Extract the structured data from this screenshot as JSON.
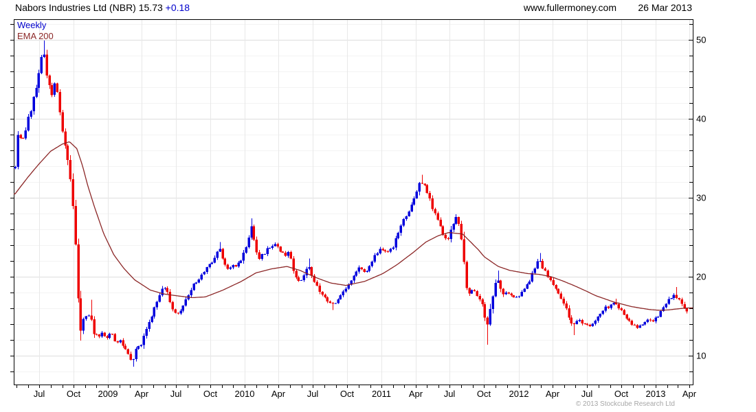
{
  "header": {
    "title_main": "Nabors Industries Ltd (NBR) 15.73",
    "change": "+0.18",
    "site": "www.fullermoney.com",
    "date": "26 Mar 2013"
  },
  "legend": {
    "timeframe": "Weekly",
    "overlay": "EMA 200"
  },
  "footer": {
    "copyright": "© 2013 Stockcube Research Ltd"
  },
  "colors": {
    "up": "#0000dd",
    "down": "#ee0000",
    "ema": "#8b2626",
    "change_text": "#0000cc",
    "legend_weekly": "#0000cc",
    "grid_major": "#dddddd",
    "grid_minor": "#f3f3f3",
    "grid_vertical": "#e8e8e8",
    "axis": "#000000",
    "copyright_text": "#a6a6a6"
  },
  "chart_data": {
    "type": "candlestick",
    "interval": "weekly",
    "instrument": "Nabors Industries Ltd (NBR)",
    "last_price": 15.73,
    "change": 0.18,
    "y_axis": {
      "side": "right",
      "ticks": [
        10,
        20,
        30,
        40,
        50
      ],
      "minor_step": 2,
      "min": 6.4,
      "max": 52.6
    },
    "x_axis": {
      "start": "2008-04-28",
      "end": "2013-03-26",
      "tick_labels": [
        {
          "d": "2008-07-01",
          "label": "Jul"
        },
        {
          "d": "2008-10-01",
          "label": "Oct"
        },
        {
          "d": "2009-01-01",
          "label": "2009"
        },
        {
          "d": "2009-04-01",
          "label": "Apr"
        },
        {
          "d": "2009-07-01",
          "label": "Jul"
        },
        {
          "d": "2009-10-01",
          "label": "Oct"
        },
        {
          "d": "2010-01-01",
          "label": "2010"
        },
        {
          "d": "2010-04-01",
          "label": "Apr"
        },
        {
          "d": "2010-07-01",
          "label": "Jul"
        },
        {
          "d": "2010-10-01",
          "label": "Oct"
        },
        {
          "d": "2011-01-01",
          "label": "2011"
        },
        {
          "d": "2011-04-01",
          "label": "Apr"
        },
        {
          "d": "2011-07-01",
          "label": "Jul"
        },
        {
          "d": "2011-10-01",
          "label": "Oct"
        },
        {
          "d": "2012-01-01",
          "label": "2012"
        },
        {
          "d": "2012-04-01",
          "label": "Apr"
        },
        {
          "d": "2012-07-01",
          "label": "Jul"
        },
        {
          "d": "2012-10-01",
          "label": "Oct"
        },
        {
          "d": "2013-01-01",
          "label": "2013"
        },
        {
          "d": "2013-04-01",
          "label": "Apr"
        }
      ]
    },
    "close_anchors": [
      [
        "2008-04-28",
        34.2
      ],
      [
        "2008-05-02",
        37.4
      ],
      [
        "2008-05-09",
        37.8
      ],
      [
        "2008-05-16",
        36.8
      ],
      [
        "2008-05-30",
        39.5
      ],
      [
        "2008-06-13",
        42.0
      ],
      [
        "2008-06-27",
        44.5
      ],
      [
        "2008-07-03",
        46.5
      ],
      [
        "2008-07-11",
        49.2
      ],
      [
        "2008-07-18",
        46.5
      ],
      [
        "2008-08-01",
        43.0
      ],
      [
        "2008-08-15",
        44.5
      ],
      [
        "2008-08-29",
        39.5
      ],
      [
        "2008-09-12",
        35.5
      ],
      [
        "2008-09-26",
        31.0
      ],
      [
        "2008-10-03",
        26.5
      ],
      [
        "2008-10-10",
        20.6
      ],
      [
        "2008-10-17",
        12.6
      ],
      [
        "2008-10-24",
        14.0
      ],
      [
        "2008-10-31",
        15.8
      ],
      [
        "2008-11-07",
        13.8
      ],
      [
        "2008-11-14",
        16.6
      ],
      [
        "2008-11-21",
        12.2
      ],
      [
        "2008-11-28",
        13.2
      ],
      [
        "2008-12-05",
        11.9
      ],
      [
        "2008-12-12",
        13.3
      ],
      [
        "2008-12-19",
        12.6
      ],
      [
        "2009-01-02",
        12.2
      ],
      [
        "2009-01-09",
        13.4
      ],
      [
        "2009-01-16",
        12.1
      ],
      [
        "2009-01-23",
        11.4
      ],
      [
        "2009-01-30",
        12.1
      ],
      [
        "2009-02-13",
        11.1
      ],
      [
        "2009-02-27",
        9.9
      ],
      [
        "2009-03-06",
        9.1
      ],
      [
        "2009-03-13",
        10.4
      ],
      [
        "2009-03-20",
        11.6
      ],
      [
        "2009-03-27",
        11.0
      ],
      [
        "2009-04-10",
        13.2
      ],
      [
        "2009-04-24",
        14.6
      ],
      [
        "2009-05-08",
        16.6
      ],
      [
        "2009-05-22",
        18.2
      ],
      [
        "2009-06-05",
        18.6
      ],
      [
        "2009-06-19",
        16.2
      ],
      [
        "2009-07-03",
        15.0
      ],
      [
        "2009-07-17",
        16.0
      ],
      [
        "2009-07-31",
        17.5
      ],
      [
        "2009-08-14",
        18.8
      ],
      [
        "2009-08-28",
        19.5
      ],
      [
        "2009-09-11",
        20.5
      ],
      [
        "2009-09-25",
        21.3
      ],
      [
        "2009-10-09",
        22.3
      ],
      [
        "2009-10-23",
        23.8
      ],
      [
        "2009-11-06",
        21.8
      ],
      [
        "2009-11-13",
        20.8
      ],
      [
        "2009-11-27",
        21.3
      ],
      [
        "2009-12-11",
        21.6
      ],
      [
        "2009-12-24",
        22.4
      ],
      [
        "2010-01-08",
        24.0
      ],
      [
        "2010-01-15",
        26.8
      ],
      [
        "2010-01-22",
        25.6
      ],
      [
        "2010-01-29",
        23.8
      ],
      [
        "2010-02-05",
        22.2
      ],
      [
        "2010-02-19",
        22.8
      ],
      [
        "2010-03-05",
        23.6
      ],
      [
        "2010-03-19",
        24.2
      ],
      [
        "2010-04-02",
        23.6
      ],
      [
        "2010-04-16",
        22.6
      ],
      [
        "2010-04-30",
        23.2
      ],
      [
        "2010-05-07",
        21.0
      ],
      [
        "2010-05-21",
        19.2
      ],
      [
        "2010-06-04",
        19.8
      ],
      [
        "2010-06-18",
        21.8
      ],
      [
        "2010-07-02",
        19.6
      ],
      [
        "2010-07-16",
        18.4
      ],
      [
        "2010-07-30",
        17.4
      ],
      [
        "2010-08-13",
        16.8
      ],
      [
        "2010-08-27",
        16.6
      ],
      [
        "2010-09-10",
        17.4
      ],
      [
        "2010-09-24",
        18.4
      ],
      [
        "2010-10-08",
        19.2
      ],
      [
        "2010-10-22",
        20.4
      ],
      [
        "2010-11-05",
        21.2
      ],
      [
        "2010-11-19",
        20.6
      ],
      [
        "2010-12-03",
        21.8
      ],
      [
        "2010-12-17",
        23.0
      ],
      [
        "2010-12-31",
        23.4
      ],
      [
        "2011-01-14",
        22.8
      ],
      [
        "2011-01-28",
        23.6
      ],
      [
        "2011-02-11",
        25.0
      ],
      [
        "2011-02-25",
        26.8
      ],
      [
        "2011-03-11",
        28.2
      ],
      [
        "2011-03-25",
        29.6
      ],
      [
        "2011-04-08",
        31.2
      ],
      [
        "2011-04-15",
        32.3
      ],
      [
        "2011-04-29",
        31.2
      ],
      [
        "2011-05-13",
        29.2
      ],
      [
        "2011-05-27",
        27.6
      ],
      [
        "2011-06-10",
        25.8
      ],
      [
        "2011-06-24",
        24.6
      ],
      [
        "2011-07-08",
        26.4
      ],
      [
        "2011-07-22",
        27.9
      ],
      [
        "2011-08-05",
        23.2
      ],
      [
        "2011-08-12",
        19.6
      ],
      [
        "2011-08-19",
        17.6
      ],
      [
        "2011-09-02",
        18.4
      ],
      [
        "2011-09-16",
        17.2
      ],
      [
        "2011-09-30",
        16.4
      ],
      [
        "2011-10-07",
        13.0
      ],
      [
        "2011-10-14",
        15.4
      ],
      [
        "2011-10-21",
        16.8
      ],
      [
        "2011-11-04",
        20.2
      ],
      [
        "2011-11-18",
        17.5
      ],
      [
        "2011-12-02",
        18.2
      ],
      [
        "2011-12-16",
        17.2
      ],
      [
        "2011-12-30",
        17.6
      ],
      [
        "2012-01-13",
        18.2
      ],
      [
        "2012-01-27",
        19.2
      ],
      [
        "2012-02-10",
        20.8
      ],
      [
        "2012-02-24",
        22.3
      ],
      [
        "2012-03-09",
        20.8
      ],
      [
        "2012-03-23",
        19.9
      ],
      [
        "2012-04-06",
        18.6
      ],
      [
        "2012-04-20",
        17.6
      ],
      [
        "2012-05-04",
        16.2
      ],
      [
        "2012-05-18",
        14.4
      ],
      [
        "2012-05-25",
        13.7
      ],
      [
        "2012-06-08",
        14.5
      ],
      [
        "2012-06-22",
        14.1
      ],
      [
        "2012-07-06",
        13.7
      ],
      [
        "2012-07-20",
        14.3
      ],
      [
        "2012-08-03",
        15.2
      ],
      [
        "2012-08-17",
        16.0
      ],
      [
        "2012-08-31",
        16.2
      ],
      [
        "2012-09-14",
        16.8
      ],
      [
        "2012-09-28",
        15.9
      ],
      [
        "2012-10-12",
        15.0
      ],
      [
        "2012-10-26",
        14.2
      ],
      [
        "2012-11-09",
        13.6
      ],
      [
        "2012-11-23",
        13.9
      ],
      [
        "2012-12-07",
        14.5
      ],
      [
        "2012-12-21",
        14.3
      ],
      [
        "2013-01-04",
        14.9
      ],
      [
        "2013-01-18",
        15.8
      ],
      [
        "2013-02-01",
        16.9
      ],
      [
        "2013-02-15",
        17.6
      ],
      [
        "2013-02-22",
        17.4
      ],
      [
        "2013-03-01",
        17.2
      ],
      [
        "2013-03-08",
        16.6
      ],
      [
        "2013-03-15",
        16.1
      ],
      [
        "2013-03-22",
        15.55
      ],
      [
        "2013-03-26",
        15.73
      ]
    ],
    "ema200_anchors": [
      [
        "2008-04-28",
        30.5
      ],
      [
        "2008-06-01",
        32.6
      ],
      [
        "2008-07-01",
        34.3
      ],
      [
        "2008-08-01",
        35.9
      ],
      [
        "2008-09-01",
        36.8
      ],
      [
        "2008-09-20",
        37.1
      ],
      [
        "2008-10-10",
        36.2
      ],
      [
        "2008-10-25",
        34.0
      ],
      [
        "2008-11-08",
        31.5
      ],
      [
        "2008-11-28",
        28.5
      ],
      [
        "2008-12-20",
        25.5
      ],
      [
        "2009-01-16",
        22.8
      ],
      [
        "2009-02-13",
        21.0
      ],
      [
        "2009-03-13",
        19.6
      ],
      [
        "2009-04-24",
        18.3
      ],
      [
        "2009-06-01",
        17.8
      ],
      [
        "2009-07-01",
        17.6
      ],
      [
        "2009-08-14",
        17.35
      ],
      [
        "2009-09-18",
        17.45
      ],
      [
        "2009-11-03",
        18.3
      ],
      [
        "2009-12-22",
        19.4
      ],
      [
        "2010-01-31",
        20.5
      ],
      [
        "2010-03-14",
        21.0
      ],
      [
        "2010-04-23",
        21.3
      ],
      [
        "2010-05-28",
        20.8
      ],
      [
        "2010-07-09",
        19.9
      ],
      [
        "2010-08-18",
        19.2
      ],
      [
        "2010-09-27",
        18.9
      ],
      [
        "2010-11-16",
        19.4
      ],
      [
        "2011-01-04",
        20.4
      ],
      [
        "2011-02-10",
        21.5
      ],
      [
        "2011-03-24",
        23.0
      ],
      [
        "2011-04-29",
        24.4
      ],
      [
        "2011-06-01",
        25.2
      ],
      [
        "2011-06-29",
        25.6
      ],
      [
        "2011-08-05",
        25.4
      ],
      [
        "2011-08-26",
        24.4
      ],
      [
        "2011-09-16",
        23.4
      ],
      [
        "2011-10-02",
        22.5
      ],
      [
        "2011-11-08",
        21.3
      ],
      [
        "2011-12-09",
        20.8
      ],
      [
        "2012-01-25",
        20.4
      ],
      [
        "2012-02-25",
        20.3
      ],
      [
        "2012-03-28",
        20.0
      ],
      [
        "2012-04-26",
        19.5
      ],
      [
        "2012-05-27",
        18.9
      ],
      [
        "2012-06-24",
        18.3
      ],
      [
        "2012-07-25",
        17.6
      ],
      [
        "2012-09-11",
        16.8
      ],
      [
        "2012-10-30",
        16.2
      ],
      [
        "2012-12-15",
        15.85
      ],
      [
        "2013-01-11",
        15.75
      ],
      [
        "2013-02-04",
        15.8
      ],
      [
        "2013-03-04",
        15.95
      ],
      [
        "2013-03-26",
        16.05
      ]
    ],
    "spikes": [
      [
        "2008-07-11",
        "high",
        49.9
      ],
      [
        "2008-10-17",
        "low",
        11.9
      ],
      [
        "2008-11-14",
        "high",
        17.1
      ],
      [
        "2009-03-06",
        "low",
        8.6
      ],
      [
        "2009-10-23",
        "high",
        24.4
      ],
      [
        "2010-01-15",
        "high",
        27.4
      ],
      [
        "2010-06-18",
        "high",
        22.3
      ],
      [
        "2010-08-20",
        "low",
        15.8
      ],
      [
        "2011-04-15",
        "high",
        32.9
      ],
      [
        "2011-10-07",
        "low",
        11.4
      ],
      [
        "2011-11-04",
        "high",
        20.8
      ],
      [
        "2012-02-24",
        "high",
        23.0
      ],
      [
        "2012-05-25",
        "low",
        12.6
      ],
      [
        "2012-09-14",
        "high",
        17.2
      ],
      [
        "2013-02-22",
        "high",
        18.7
      ]
    ]
  }
}
